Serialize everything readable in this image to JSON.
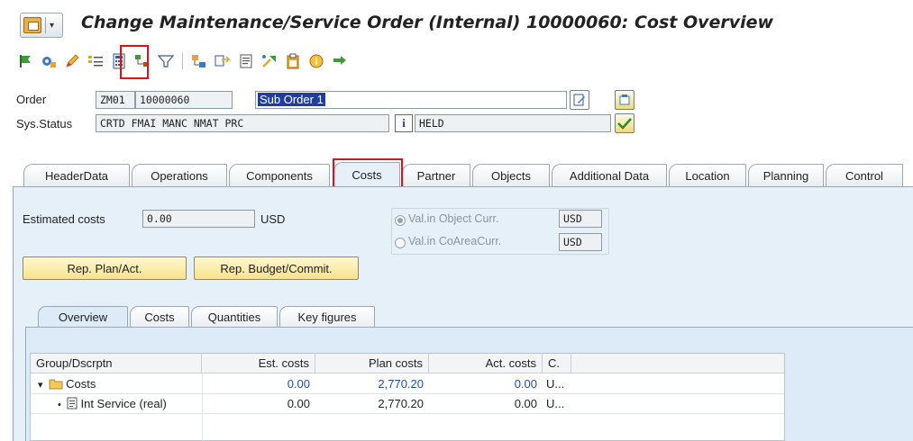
{
  "window": {
    "title": "Change Maintenance/Service Order (Internal) 10000060: Cost Overview"
  },
  "toolbar": {
    "icons": [
      "flag-icon",
      "settings-icon",
      "edit-icon",
      "list-icon",
      "calculator-icon",
      "hierarchy-icon",
      "filter-icon",
      "structure-icon",
      "copy-icon",
      "document-icon",
      "release-icon",
      "clipboard-icon",
      "info-icon",
      "next-icon"
    ]
  },
  "header": {
    "order_label": "Order",
    "order_type": "ZM01",
    "order_number": "10000060",
    "order_description": "Sub Order 1",
    "sys_status_label": "Sys.Status",
    "sys_status": "CRTD FMAI MANC NMAT PRC",
    "info_glyph": "i",
    "user_status": "HELD"
  },
  "tabs": [
    {
      "label": "HeaderData"
    },
    {
      "label": "Operations"
    },
    {
      "label": "Components"
    },
    {
      "label": "Costs"
    },
    {
      "label": "Partner"
    },
    {
      "label": "Objects"
    },
    {
      "label": "Additional Data"
    },
    {
      "label": "Location"
    },
    {
      "label": "Planning"
    },
    {
      "label": "Control"
    }
  ],
  "costs_tab": {
    "estimated_costs_label": "Estimated costs",
    "estimated_costs_value": "0.00",
    "currency": "USD",
    "radio_object_curr_label": "Val.in Object Curr.",
    "radio_object_curr_value": "USD",
    "radio_coarea_curr_label": "Val.in CoAreaCurr.",
    "radio_coarea_curr_value": "USD",
    "btn_plan_act": "Rep. Plan/Act.",
    "btn_budget_commit": "Rep. Budget/Commit."
  },
  "subtabs": [
    {
      "label": "Overview"
    },
    {
      "label": "Costs"
    },
    {
      "label": "Quantities"
    },
    {
      "label": "Key figures"
    }
  ],
  "table": {
    "columns": [
      "Group/Dscrptn",
      "Est. costs",
      "Plan costs",
      "Act. costs",
      "C."
    ],
    "rows": [
      {
        "expander": "▾",
        "desc": "Costs",
        "est": "0.00",
        "plan": "2,770.20",
        "act": "0.00",
        "c": "U..."
      },
      {
        "expander": "•",
        "desc": "Int Service (real)",
        "est": "0.00",
        "plan": "2,770.20",
        "act": "0.00",
        "c": "U..."
      }
    ]
  },
  "colors": {
    "highlight": "#e0101a",
    "panel": "#e5f0f9",
    "selection": "#1f3e9e"
  }
}
